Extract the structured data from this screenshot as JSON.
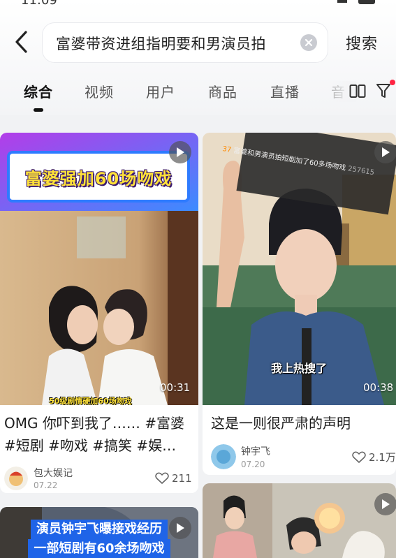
{
  "status": {
    "time": "11:09"
  },
  "search": {
    "query": "富婆带资进组指明要和男演员拍",
    "submit_label": "搜索"
  },
  "tabs": [
    {
      "label": "综合",
      "active": true
    },
    {
      "label": "视频",
      "active": false
    },
    {
      "label": "用户",
      "active": false
    },
    {
      "label": "商品",
      "active": false
    },
    {
      "label": "直播",
      "active": false
    },
    {
      "label": "音",
      "active": false
    }
  ],
  "cards": [
    {
      "banner_text": "富婆强加60场吻戏",
      "caption_text": "50级剧情硬加60场吻戏",
      "duration": "00:31",
      "title": "OMG 你吓到我了…… #富婆 #短剧 #吻戏 #搞笑 #娱…",
      "author": "包大娱记",
      "date": "07.22",
      "likes": "211"
    },
    {
      "overlay_rank": "37",
      "overlay_text": "富婆和男演员拍短剧加了60多场吻戏",
      "overlay_count": "257615",
      "subtitle": "我上热搜了",
      "duration": "00:38",
      "title": "这是一则很严肃的声明",
      "author": "钟宇飞",
      "date": "07.20",
      "likes": "2.1万"
    },
    {
      "banner_line1": "演员钟宇飞曝接戏经历",
      "banner_line2": "一部短剧有60余场吻戏"
    },
    {}
  ],
  "colors": {
    "accent_red": "#ff2442",
    "banner_yellow": "#ffe23a",
    "banner_border": "#2e7bff",
    "banner_bg": "#b73cf0"
  }
}
